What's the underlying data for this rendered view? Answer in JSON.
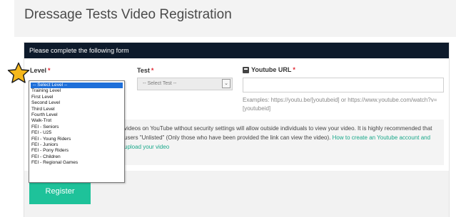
{
  "page": {
    "title": "Dressage Tests Video Registration"
  },
  "form": {
    "header": "Please complete the following form",
    "level": {
      "label": "Level",
      "required_mark": "*",
      "options": [
        "-- Select Level --",
        "Training Level",
        "First Level",
        "Second Level",
        "Third Level",
        "Fourth Level",
        "Walk-Trot",
        "FEI - Seniors",
        "FEI - U25",
        "FEI - Young Riders",
        "FEI - Juniors",
        "FEI - Pony Riders",
        "FEI - Children",
        "FEI - Regional Games"
      ],
      "selected": "-- Select Level --"
    },
    "test": {
      "label": "Test",
      "required_mark": "*",
      "value": "-- Select Test --",
      "arrow": "⌄"
    },
    "youtube": {
      "icon": "youtube-icon",
      "label": "Youtube URL",
      "required_mark": "*",
      "value": "",
      "examples": "Examples: https://youtu.be/[youtubeid] or https://www.youtube.com/watch?v=[youtubeid]"
    },
    "notice": {
      "text": "videos on YouTube without security settings will allow outside individuals to view your video. It is highly recommended that users \"Unlisted\" (Only those who have been provided the link can view the video).",
      "link": "How to create an Youtube account and upload your video"
    },
    "register_label": "Register"
  },
  "colors": {
    "header_bg": "#0d1a2b",
    "required": "#e0242f",
    "button": "#1ec29a",
    "link": "#1aa88a",
    "dropdown_selected": "#1e6fd9",
    "star": "#f5b81c"
  }
}
